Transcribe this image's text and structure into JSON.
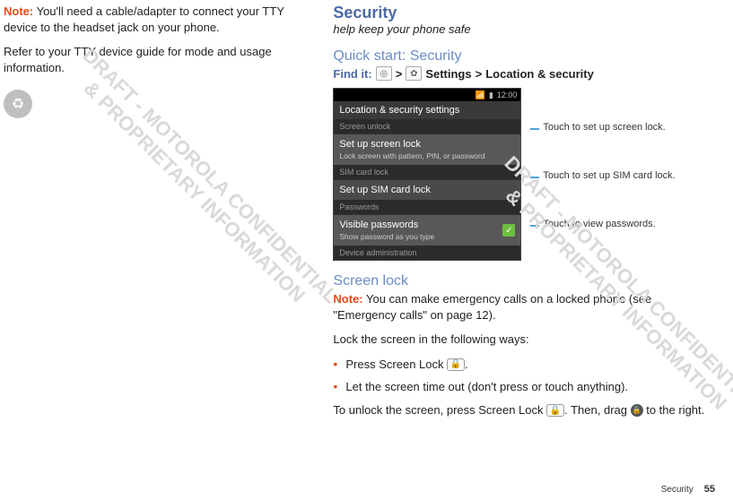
{
  "left": {
    "note_label": "Note:",
    "note_text": " You'll need a cable/adapter to connect your TTY device to the headset jack on your phone.",
    "refer": "Refer to your TTY device guide for mode and usage information."
  },
  "right": {
    "title": "Security",
    "subtitle": "help keep your phone safe",
    "quick_start": "Quick start: Security",
    "findit_label": "Find it:",
    "gt": ">",
    "settings": "Settings",
    "loc_sec": "Location & security",
    "phone": {
      "time": "12:00",
      "header": "Location & security settings",
      "sec1": "Screen unlock",
      "row1_main": "Set up screen lock",
      "row1_sub": "Lock screen with pattern, PIN, or password",
      "sec2": "SIM card lock",
      "row2_main": "Set up SIM card lock",
      "sec3": "Passwords",
      "row3_main": "Visible passwords",
      "row3_sub": "Show password as you type",
      "sec4": "Device administration"
    },
    "callouts": {
      "c1": "Touch to set up screen lock.",
      "c2": "Touch to set up SIM card lock.",
      "c3": "Touch to view passwords."
    },
    "screen_lock_h": "Screen lock",
    "sl_note_label": "Note:",
    "sl_note_text": " You can make emergency calls on a locked phone (see \"Emergency calls\" on page 12).",
    "sl_lock_ways": "Lock the screen in the following ways:",
    "sl_b1_a": "Press Screen Lock ",
    "sl_b1_b": ".",
    "sl_b2": "Let the screen time out (don't press or touch anything).",
    "sl_unlock_a": "To unlock the screen, press Screen Lock ",
    "sl_unlock_b": ". Then, drag ",
    "sl_unlock_c": " to the right."
  },
  "watermark": {
    "l1": "DRAFT - MOTOROLA CONFIDENTIAL",
    "l2": "& PROPRIETARY INFORMATION"
  },
  "footer": {
    "section": "Security",
    "page": "55"
  },
  "icons": {
    "circle": "◎",
    "gear": "✿",
    "lock": "🔒",
    "drag": "🔒▸",
    "check": "✓",
    "recycle": "♻"
  }
}
